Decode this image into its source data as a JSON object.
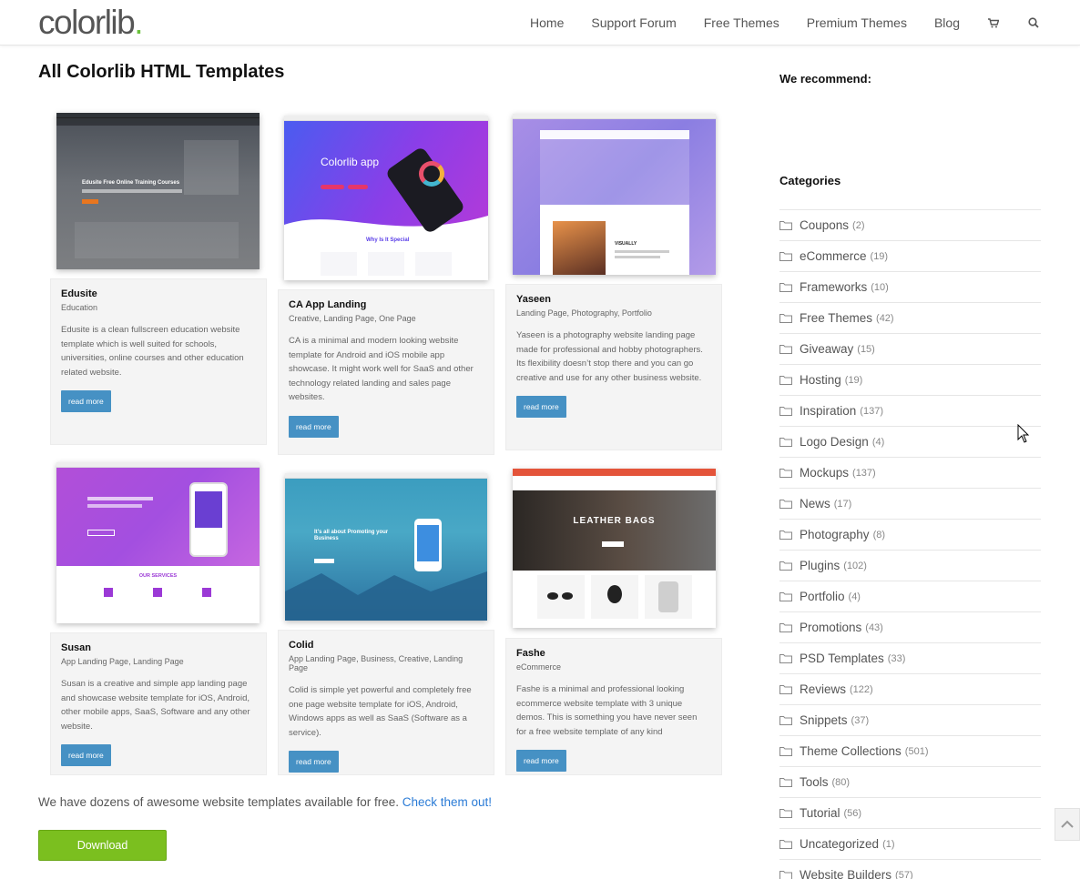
{
  "logo": {
    "text": "colorlib",
    "dot": "."
  },
  "nav": {
    "items": [
      "Home",
      "Support Forum",
      "Free Themes",
      "Premium Themes",
      "Blog"
    ]
  },
  "main": {
    "title": "All Colorlib HTML Templates",
    "cards": [
      {
        "name": "Edusite",
        "cats": "Education",
        "desc": "Edusite is a clean fullscreen education website template which is well suited for schools, universities, online courses and other education related website.",
        "btn": "read more",
        "thumb_title": "Edusite Free Online Training Courses"
      },
      {
        "name": "CA App Landing",
        "cats": "Creative, Landing Page, One Page",
        "desc": "CA is a minimal and modern looking website template for Android and iOS mobile app showcase. It might work well for SaaS and other technology related landing and sales page websites.",
        "btn": "read more",
        "thumb_title": "Colorlib app",
        "thumb_sub": "Why Is It Special"
      },
      {
        "name": "Yaseen",
        "cats": "Landing Page, Photography, Portfolio",
        "desc": "Yaseen is a photography website landing page made for professional and hobby photographers. Its flexibility doesn’t stop there and you can go creative and use for any other business website.",
        "btn": "read more",
        "thumb_title": "VISUALLY"
      },
      {
        "name": "Susan",
        "cats": "App Landing Page, Landing Page",
        "desc": "Susan is a creative and simple app landing page and showcase website template for iOS, Android, other mobile apps, SaaS, Software and any other website.",
        "btn": "read more",
        "thumb_title": "OUR SERVICES"
      },
      {
        "name": "Colid",
        "cats": "App Landing Page, Business, Creative, Landing Page",
        "desc": "Colid is simple yet powerful and completely free one page website template for iOS, Android, Windows apps as well as SaaS (Software as a service).",
        "btn": "read more",
        "thumb_title": "It’s all about Promoting your Business"
      },
      {
        "name": "Fashe",
        "cats": "eCommerce",
        "desc": "Fashe is a minimal and professional looking ecommerce website template with 3 unique demos. This is something you have never seen for a free website template of any kind",
        "btn": "read more",
        "thumb_title": "LEATHER BAGS"
      }
    ],
    "footer_text": "We have dozens of awesome website templates available for free. ",
    "footer_link": "Check them out!",
    "download": "Download"
  },
  "sidebar": {
    "recommend": "We recommend:",
    "categories_title": "Categories",
    "categories": [
      {
        "name": "Coupons",
        "count": "(2)"
      },
      {
        "name": "eCommerce",
        "count": "(19)"
      },
      {
        "name": "Frameworks",
        "count": "(10)"
      },
      {
        "name": "Free Themes",
        "count": "(42)"
      },
      {
        "name": "Giveaway",
        "count": "(15)"
      },
      {
        "name": "Hosting",
        "count": "(19)"
      },
      {
        "name": "Inspiration",
        "count": "(137)"
      },
      {
        "name": "Logo Design",
        "count": "(4)"
      },
      {
        "name": "Mockups",
        "count": "(137)"
      },
      {
        "name": "News",
        "count": "(17)"
      },
      {
        "name": "Photography",
        "count": "(8)"
      },
      {
        "name": "Plugins",
        "count": "(102)"
      },
      {
        "name": "Portfolio",
        "count": "(4)"
      },
      {
        "name": "Promotions",
        "count": "(43)"
      },
      {
        "name": "PSD Templates",
        "count": "(33)"
      },
      {
        "name": "Reviews",
        "count": "(122)"
      },
      {
        "name": "Snippets",
        "count": "(37)"
      },
      {
        "name": "Theme Collections",
        "count": "(501)"
      },
      {
        "name": "Tools",
        "count": "(80)"
      },
      {
        "name": "Tutorial",
        "count": "(56)"
      },
      {
        "name": "Uncategorized",
        "count": "(1)"
      },
      {
        "name": "Website Builders",
        "count": "(57)"
      }
    ]
  },
  "colors": {
    "accent": "#4691c4",
    "download": "#7bbf1f",
    "logo_dot": "#6ac13c",
    "link": "#2a7bd6"
  }
}
